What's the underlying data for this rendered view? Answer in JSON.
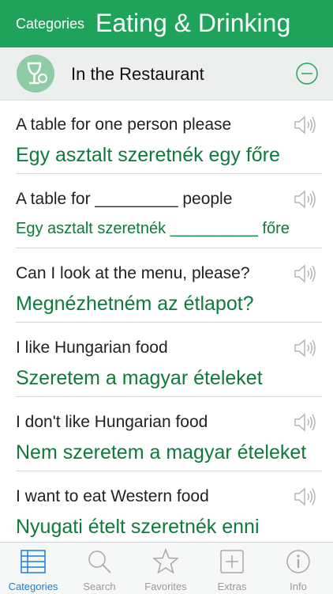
{
  "header": {
    "back_label": "Categories",
    "title": "Eating & Drinking"
  },
  "section": {
    "label": "In the Restaurant",
    "icon": "wine-glass-icon"
  },
  "phrases": [
    {
      "en": "A table for one person please",
      "hu": "Egy asztalt szeretnék egy főre"
    },
    {
      "en": "A table for _________ people",
      "hu": "Egy asztalt szeretnék __________  főre"
    },
    {
      "en": "Can I look at the menu, please?",
      "hu": "Megnézhetném az étlapot?"
    },
    {
      "en": "I like Hungarian food",
      "hu": "Szeretem a magyar ételeket"
    },
    {
      "en": "I don't like Hungarian food",
      "hu": "Nem szeretem a magyar ételeket"
    },
    {
      "en": "I want to eat Western food",
      "hu": "Nyugati ételt szeretnék enni"
    }
  ],
  "tabs": [
    {
      "label": "Categories",
      "icon": "list-icon",
      "active": true
    },
    {
      "label": "Search",
      "icon": "search-icon"
    },
    {
      "label": "Favorites",
      "icon": "star-icon"
    },
    {
      "label": "Extras",
      "icon": "plus-square-icon"
    },
    {
      "label": "Info",
      "icon": "info-icon"
    }
  ],
  "colors": {
    "accent": "#1fa35a",
    "phrase_green": "#0e7a3c",
    "tab_active": "#1a7fd6"
  }
}
